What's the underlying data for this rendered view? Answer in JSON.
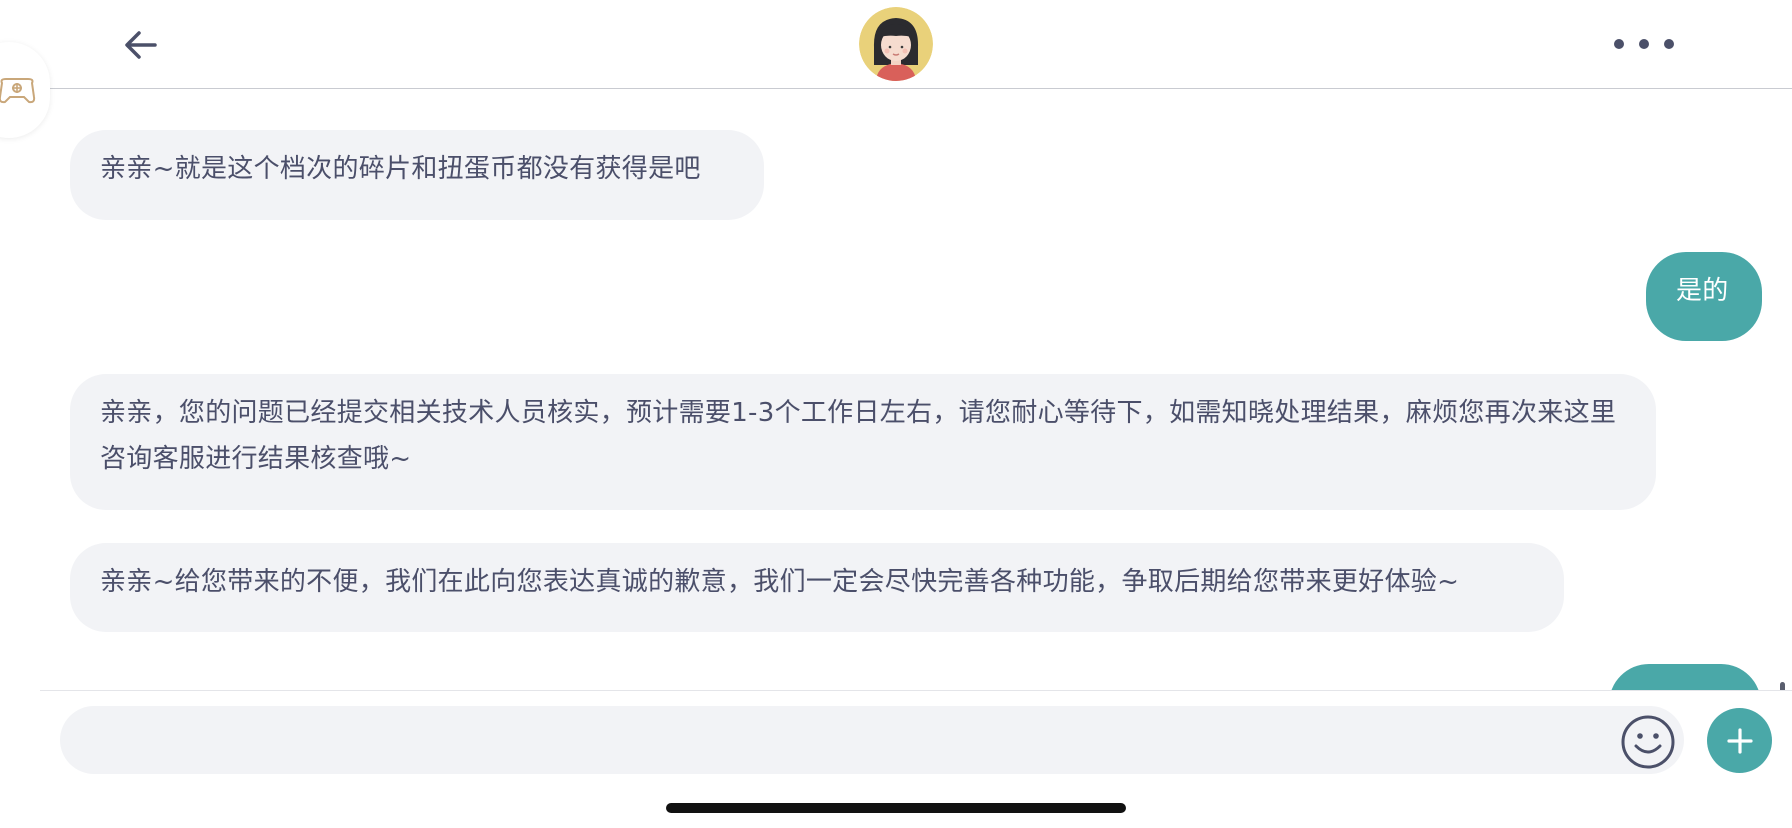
{
  "header": {
    "back_icon": "arrow-left-icon",
    "avatar_icon": "agent-avatar",
    "more_icon": "more-horizontal-icon"
  },
  "floating": {
    "icon": "gamepad-icon"
  },
  "messages": [
    {
      "sender": "agent",
      "text": "亲亲~就是这个档次的碎片和扭蛋币都没有获得是吧"
    },
    {
      "sender": "user",
      "text": "是的"
    },
    {
      "sender": "agent",
      "text": "亲亲，您的问题已经提交相关技术人员核实，预计需要1-3个工作日左右，请您耐心等待下，如需知晓处理结果，麻烦您再次来这里咨询客服进行结果核查哦~"
    },
    {
      "sender": "agent",
      "text": "亲亲~给您带来的不便，我们在此向您表达真诚的歉意，我们一定会尽快完善各种功能，争取后期给您带来更好体验~"
    },
    {
      "sender": "user",
      "text": ""
    }
  ],
  "input": {
    "value": "",
    "placeholder": "",
    "emoji_icon": "smiley-icon",
    "plus_icon": "plus-icon"
  },
  "colors": {
    "accent": "#4aa8a8",
    "agent_bubble": "#f2f3f6",
    "text": "#4b4f6a"
  }
}
